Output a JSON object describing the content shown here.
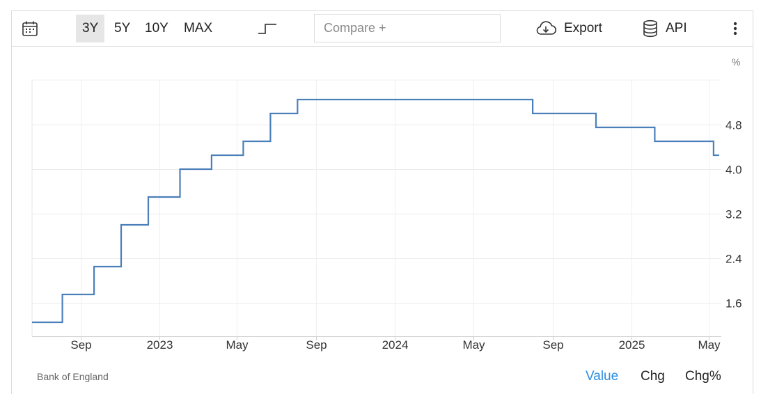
{
  "toolbar": {
    "calendar_icon": "calendar-icon",
    "ranges": [
      "3Y",
      "5Y",
      "10Y",
      "MAX"
    ],
    "active_range": "3Y",
    "chart_type_icon": "step-line-icon",
    "compare_placeholder": "Compare +",
    "export_label": "Export",
    "export_icon": "cloud-download-icon",
    "api_label": "API",
    "api_icon": "database-icon",
    "more_icon": "more-vertical-icon"
  },
  "footer": {
    "source": "Bank of England",
    "tabs": [
      "Value",
      "Chg",
      "Chg%"
    ],
    "active_tab": "Value",
    "active_color": "#2a8ee4"
  },
  "chart_data": {
    "type": "line",
    "step": true,
    "unit_label": "%",
    "color": "#4a7fba",
    "ylim": [
      1.0,
      5.6
    ],
    "yticks": [
      1.6,
      2.4,
      3.2,
      4.0,
      4.8
    ],
    "ytick_labels": [
      "1.6",
      "2.4",
      "3.2",
      "4.0",
      "4.8"
    ],
    "xlim": [
      "2022-06-18",
      "2025-05-20"
    ],
    "xticks": [
      "2022-09-01",
      "2023-01-01",
      "2023-05-01",
      "2023-09-01",
      "2024-01-01",
      "2024-05-01",
      "2024-09-01",
      "2025-01-01",
      "2025-05-01"
    ],
    "xtick_labels": [
      "Sep",
      "2023",
      "May",
      "Sep",
      "2024",
      "May",
      "Sep",
      "2025",
      "May"
    ],
    "grid": true,
    "series": [
      {
        "x": [
          "2022-06-18",
          "2022-08-04",
          "2022-09-22",
          "2022-11-03",
          "2022-12-15",
          "2023-02-02",
          "2023-03-23",
          "2023-05-11",
          "2023-06-22",
          "2023-08-03",
          "2024-08-01",
          "2024-11-07",
          "2025-02-06",
          "2025-05-08"
        ],
        "y": [
          1.25,
          1.75,
          2.25,
          3.0,
          3.5,
          4.0,
          4.25,
          4.5,
          5.0,
          5.25,
          5.0,
          4.75,
          4.5,
          4.25
        ]
      }
    ]
  }
}
